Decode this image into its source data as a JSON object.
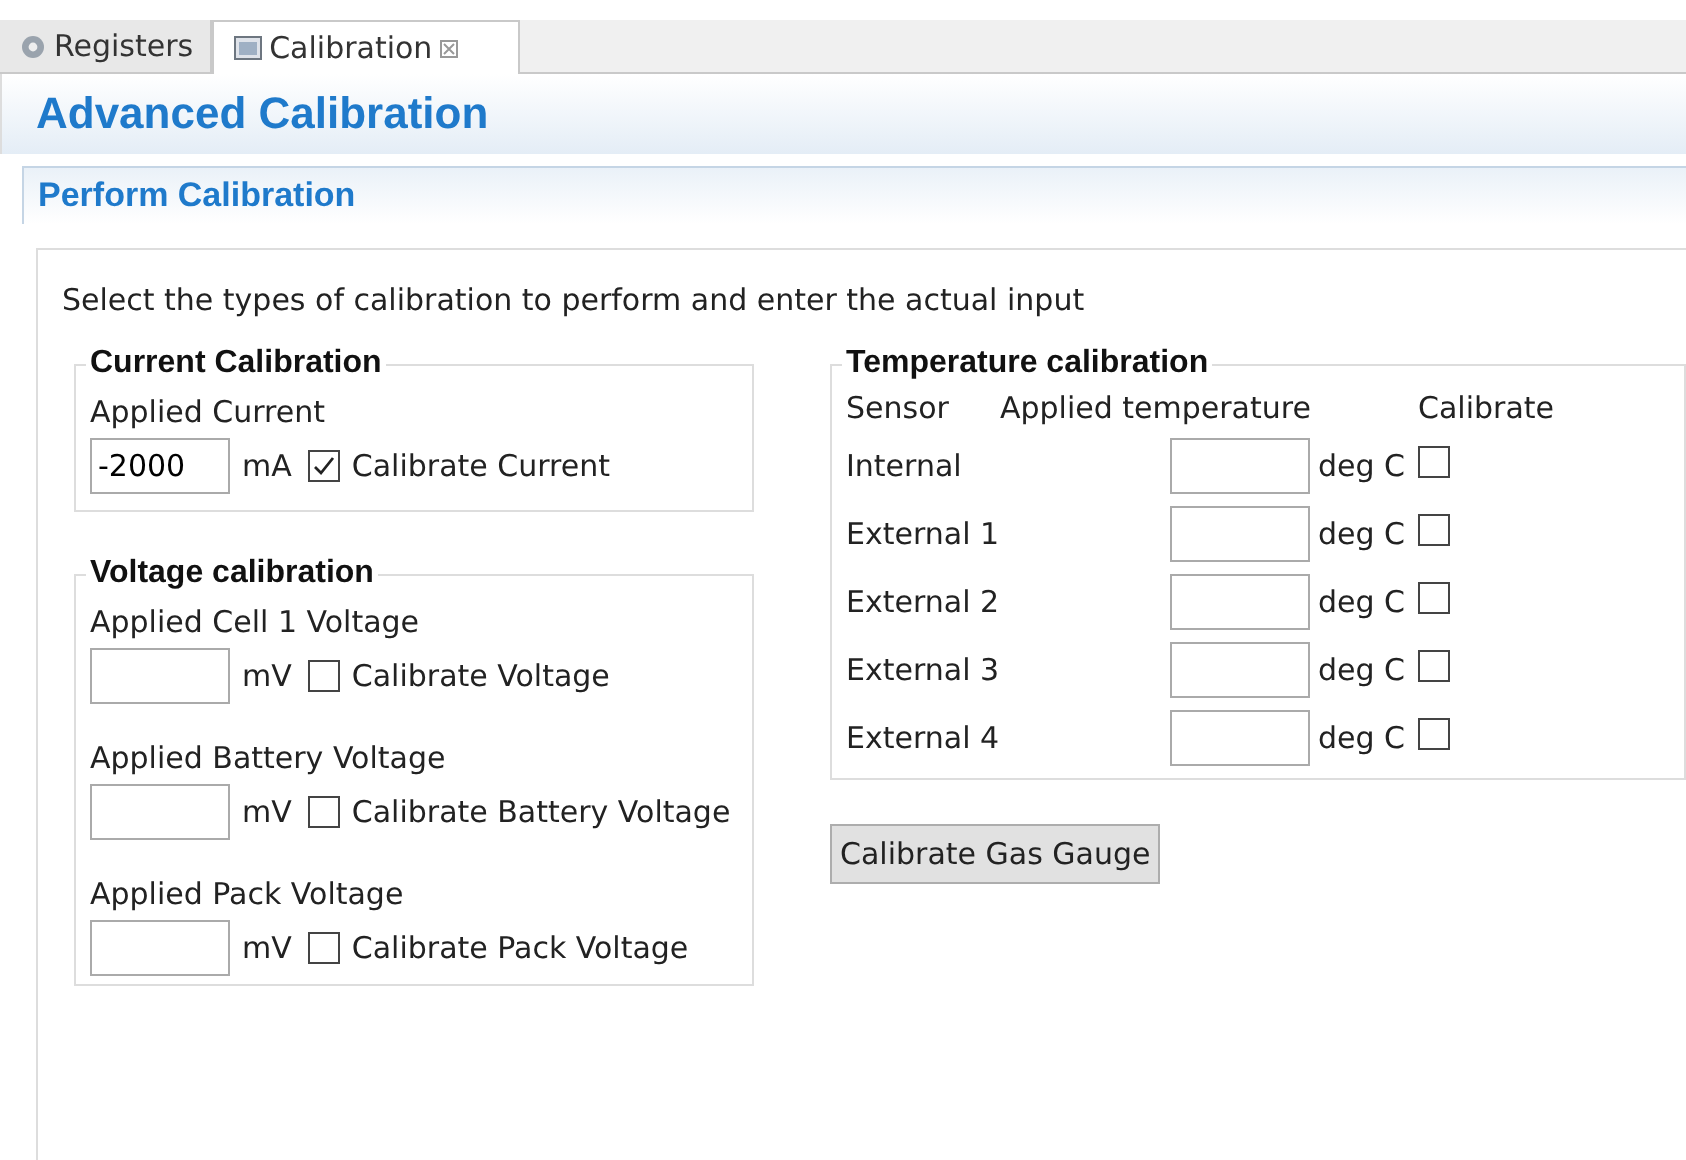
{
  "tabs": [
    {
      "label": "Registers",
      "selected": false
    },
    {
      "label": "Calibration",
      "selected": true
    }
  ],
  "title": "Advanced Calibration",
  "section": "Perform Calibration",
  "instructions": "Select the types of calibration to perform and enter the actual input",
  "current": {
    "title": "Current Calibration",
    "label": "Applied Current",
    "value": "-2000",
    "unit": "mA",
    "checkbox": "Calibrate Current",
    "checked": true
  },
  "voltage": {
    "title": "Voltage calibration",
    "rows": [
      {
        "label": "Applied Cell 1 Voltage",
        "unit": "mV",
        "checkbox": "Calibrate Voltage",
        "checked": false
      },
      {
        "label": "Applied Battery Voltage",
        "unit": "mV",
        "checkbox": "Calibrate Battery Voltage",
        "checked": false
      },
      {
        "label": "Applied Pack Voltage",
        "unit": "mV",
        "checkbox": "Calibrate Pack Voltage",
        "checked": false
      }
    ]
  },
  "temperature": {
    "title": "Temperature calibration",
    "columns": [
      "Sensor",
      "Applied temperature",
      "Calibrate"
    ],
    "rows": [
      {
        "sensor": "Internal",
        "unit": "deg C",
        "checked": false
      },
      {
        "sensor": "External 1",
        "unit": "deg C",
        "checked": false
      },
      {
        "sensor": "External 2",
        "unit": "deg C",
        "checked": false
      },
      {
        "sensor": "External 3",
        "unit": "deg C",
        "checked": false
      },
      {
        "sensor": "External 4",
        "unit": "deg C",
        "checked": false
      }
    ]
  },
  "button": "Calibrate Gas Gauge"
}
